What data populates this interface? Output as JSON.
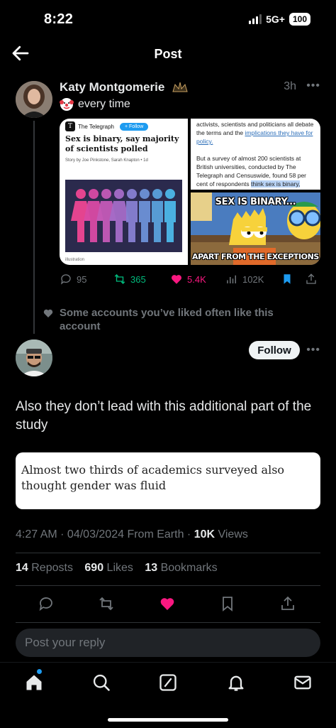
{
  "status_bar": {
    "time": "8:22",
    "network": "5G+",
    "battery": "100"
  },
  "header": {
    "title": "Post"
  },
  "parent_post": {
    "author": "Katy Montgomerie",
    "bio_suffix": "every time",
    "time_ago": "3h",
    "media": {
      "card1": {
        "source": "The Telegraph",
        "follow_label": "+ Follow",
        "headline": "Sex is binary, say majority of scientists polled",
        "byline": "Story by Joe Pinkstone, Sarah Knapton  •  1d",
        "caption": "illustration"
      },
      "card2": {
        "text1_start": "activists, scientists and politicians all debate the terms and the ",
        "text1_link": "implications they have for policy.",
        "text2_start": "But a survey of almost 200 scientists at British universities, conducted by The Telegraph and Censuswide, found 58 per cent of respondents ",
        "text2_highlight": "think sex is binary,"
      },
      "meme": {
        "top": "SEX IS BINARY...",
        "bottom": "APART FROM THE EXCEPTIONS"
      }
    },
    "actions": {
      "replies": "95",
      "reposts": "365",
      "likes": "5.4K",
      "views": "102K"
    }
  },
  "liked_note": "Some accounts you’ve liked often like this account",
  "main_post": {
    "follow_label": "Follow",
    "text": "Also they don’t lead with this additional part of the study",
    "quote": "Almost two thirds of academics surveyed also thought gender was fluid",
    "meta_prefix": "4:27 AM · 04/03/2024 From Earth · ",
    "views_count": "10K",
    "views_label": " Views",
    "stats": {
      "reposts_count": "14",
      "reposts_label": " Reposts",
      "likes_count": "690",
      "likes_label": " Likes",
      "bookmarks_count": "13",
      "bookmarks_label": " Bookmarks"
    }
  },
  "reply": {
    "placeholder": "Post your reply"
  },
  "colors": {
    "accent": "#1d9bf0",
    "like": "#f91880",
    "repost": "#00ba7c",
    "muted": "#71767b"
  }
}
